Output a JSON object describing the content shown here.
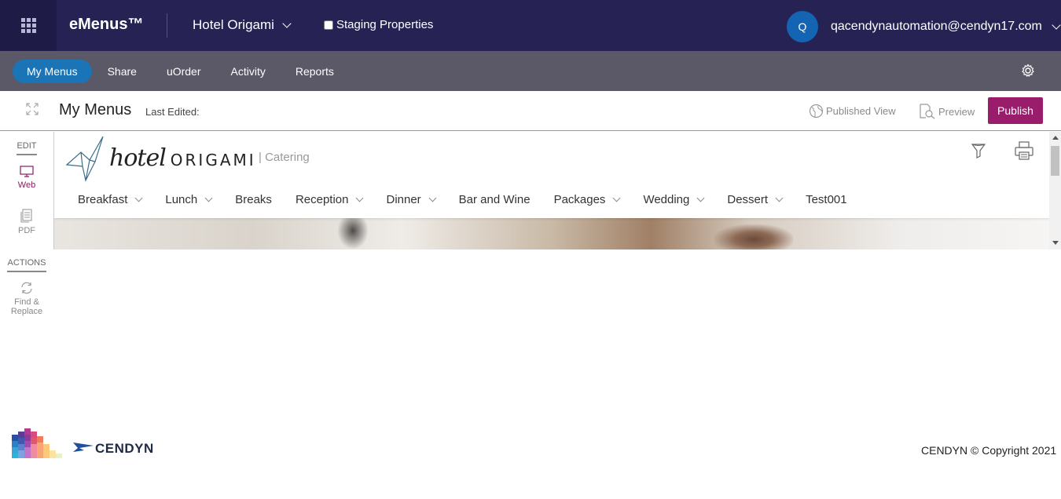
{
  "topbar": {
    "brand": "eMenus™",
    "property": "Hotel Origami",
    "staging_label": "Staging Properties",
    "staging_checked": false,
    "avatar_initial": "Q",
    "user_email": "qacendynautomation@cendyn17.com"
  },
  "nav": {
    "tabs": [
      {
        "label": "My Menus",
        "active": true
      },
      {
        "label": "Share",
        "active": false
      },
      {
        "label": "uOrder",
        "active": false
      },
      {
        "label": "Activity",
        "active": false
      },
      {
        "label": "Reports",
        "active": false
      }
    ]
  },
  "toolbar": {
    "title": "My Menus",
    "last_edited_label": "Last Edited:",
    "published_view_label": "Published View",
    "preview_label": "Preview",
    "publish_label": "Publish"
  },
  "sidebar": {
    "edit_label": "EDIT",
    "web_label": "Web",
    "pdf_label": "PDF",
    "actions_label": "ACTIONS",
    "find_replace_line1": "Find &",
    "find_replace_line2": "Replace"
  },
  "preview": {
    "logo_hotel": "hotel",
    "logo_origami": "ORIGAMI",
    "subtitle": "| Catering",
    "menu": [
      {
        "label": "Breakfast",
        "has_dropdown": true
      },
      {
        "label": "Lunch",
        "has_dropdown": true
      },
      {
        "label": "Breaks",
        "has_dropdown": false
      },
      {
        "label": "Reception",
        "has_dropdown": true
      },
      {
        "label": "Dinner",
        "has_dropdown": true
      },
      {
        "label": "Bar and Wine",
        "has_dropdown": false
      },
      {
        "label": "Packages",
        "has_dropdown": true
      },
      {
        "label": "Wedding",
        "has_dropdown": true
      },
      {
        "label": "Dessert",
        "has_dropdown": true
      },
      {
        "label": "Test001",
        "has_dropdown": false
      }
    ]
  },
  "footer": {
    "company": "CENDYN",
    "copyright": "CENDYN © Copyright 2021"
  },
  "colors": {
    "topbar": "#262354",
    "navbar": "#5b5967",
    "active_tab": "#1a74b5",
    "publish": "#9a1d6b",
    "avatar": "#1464b4"
  }
}
